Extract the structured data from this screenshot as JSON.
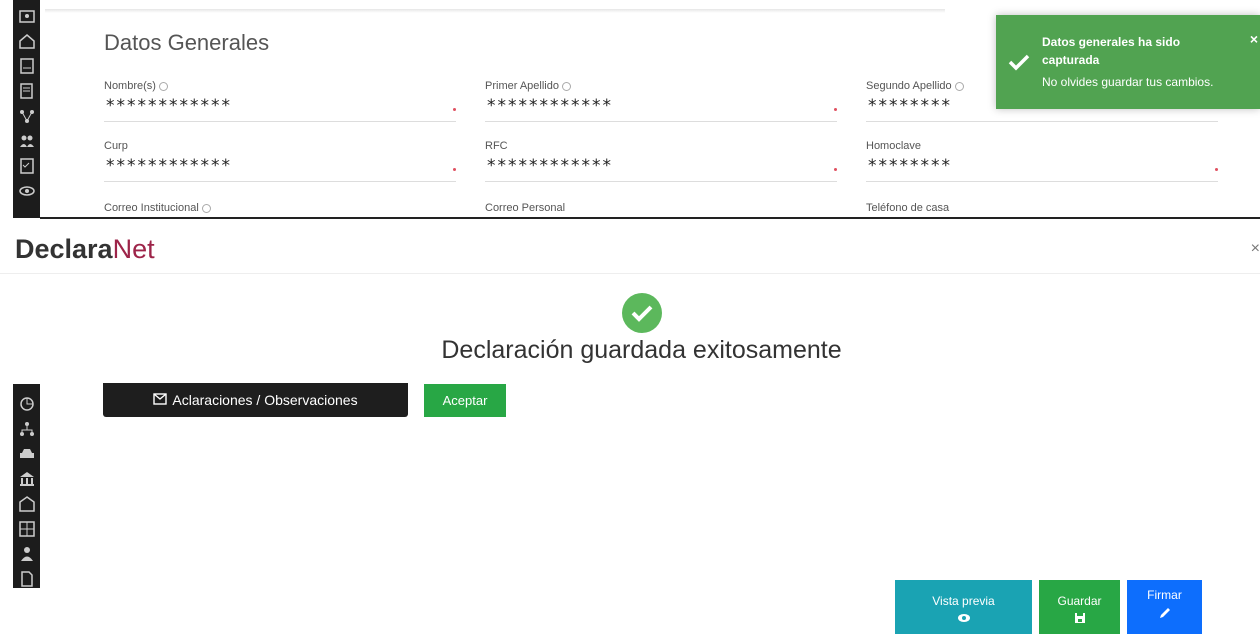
{
  "form": {
    "section_title": "Datos Generales",
    "fields": [
      {
        "label": "Nombre(s)",
        "value": "************"
      },
      {
        "label": "Primer Apellido",
        "value": "************"
      },
      {
        "label": "Segundo Apellido",
        "value": "********"
      },
      {
        "label": "Curp",
        "value": "************"
      },
      {
        "label": "RFC",
        "value": "************"
      },
      {
        "label": "Homoclave",
        "value": "********"
      },
      {
        "label": "Correo Institucional",
        "value": ""
      },
      {
        "label": "Correo Personal",
        "value": ""
      },
      {
        "label": "Teléfono de casa",
        "value": ""
      }
    ]
  },
  "toast": {
    "title": "Datos generales ha sido capturada",
    "message": "No olvides guardar tus cambios.",
    "close": "×",
    "color": "#51a351"
  },
  "modal": {
    "brand_bold": "Declara",
    "brand_light": "Net",
    "close": "×",
    "message": "Declaración guardada exitosamente",
    "aclaraciones_label": "Aclaraciones / Observaciones",
    "aceptar_label": "Aceptar"
  },
  "actions": {
    "vista_previa": "Vista previa",
    "guardar": "Guardar",
    "firmar": "Firmar"
  },
  "colors": {
    "brand_accent": "#9d2449",
    "success": "#5cb85c",
    "teal": "#1aa3b3",
    "blue": "#0d6efd"
  }
}
